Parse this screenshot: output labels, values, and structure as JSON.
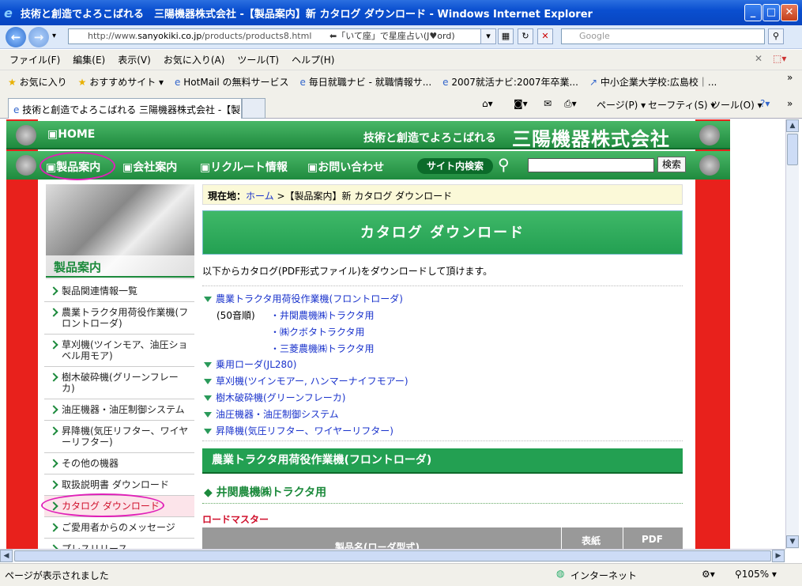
{
  "window": {
    "title": "技術と創造でよろこばれる　三陽機器株式会社 -【製品案内】新 カタログ ダウンロード - Windows Internet Explorer"
  },
  "address": {
    "prefix": "http://www.",
    "domain": "sanyokiki.co.jp",
    "path": "/products/products8.html",
    "note": "⬅「いて座」で星座占い(J♥ord)"
  },
  "search": {
    "placeholder": "Google"
  },
  "menu": [
    "ファイル(F)",
    "編集(E)",
    "表示(V)",
    "お気に入り(A)",
    "ツール(T)",
    "ヘルプ(H)"
  ],
  "favorites": {
    "label": "お気に入り",
    "items": [
      "おすすめサイト ▾",
      "HotMail の無料サービス",
      "毎日就職ナビ - 就職情報サ...",
      "2007就活ナビ:2007年卒業...",
      "中小企業大学校:広島校｜..."
    ]
  },
  "tab": {
    "label": "技術と創造でよろこばれる 三陽機器株式会社 -【製..."
  },
  "tools": {
    "page": "ページ(P) ▾",
    "safety": "セーフティ(S) ▾",
    "tool": "ツール(O) ▾"
  },
  "site": {
    "home": "HOME",
    "tagline": "技術と創造でよろこばれる",
    "company": "三陽機器株式会社",
    "nav": [
      "製品案内",
      "会社案内",
      "リクルート情報",
      "お問い合わせ"
    ],
    "site_search": "サイト内検索",
    "search_button": "検索",
    "side_title": "製品案内",
    "sidebar": [
      "製品関連情報一覧",
      "農業トラクタ用荷役作業機(フロントローダ)",
      "草刈機(ツインモア、油圧ショベル用モア)",
      "樹木破砕機(グリーンフレーカ)",
      "油圧機器・油圧制御システム",
      "昇降機(気圧リフター、ワイヤーリフター)",
      "その他の機器",
      "取扱説明書 ダウンロード",
      "カタログ ダウンロード",
      "ご愛用者からのメッセージ",
      "プレスリリース"
    ],
    "crumb_label": "現在地：",
    "crumb_home": "ホーム",
    "crumb_rest": " >【製品案内】新 カタログ ダウンロード",
    "banner": "カタログ ダウンロード",
    "intro": "以下からカタログ(PDF形式ファイル)をダウンロードして頂けます。",
    "cat1": "農業トラクタ用荷役作業機(フロントローダ)",
    "order": "(50音順)",
    "sub": [
      "・井関農機㈱トラクタ用",
      "・㈱クボタトラクタ用",
      "・三菱農機㈱トラクタ用"
    ],
    "cats": [
      "乗用ローダ(JL280)",
      "草刈機(ツインモアー, ハンマーナイフモアー)",
      "樹木破砕機(グリーンフレーカ)",
      "油圧機器・油圧制御システム",
      "昇降機(気圧リフター、ワイヤーリフター)"
    ],
    "section": "農業トラクタ用荷役作業機(フロントローダ)",
    "subhead": "◆ 井関農機㈱トラクタ用",
    "lm": "ロードマスター",
    "th": [
      "製品名(ローダ型式)",
      "表紙",
      "PDF"
    ]
  },
  "status": {
    "left": "ページが表示されました",
    "zone": "インターネット",
    "zoom": "105%"
  }
}
